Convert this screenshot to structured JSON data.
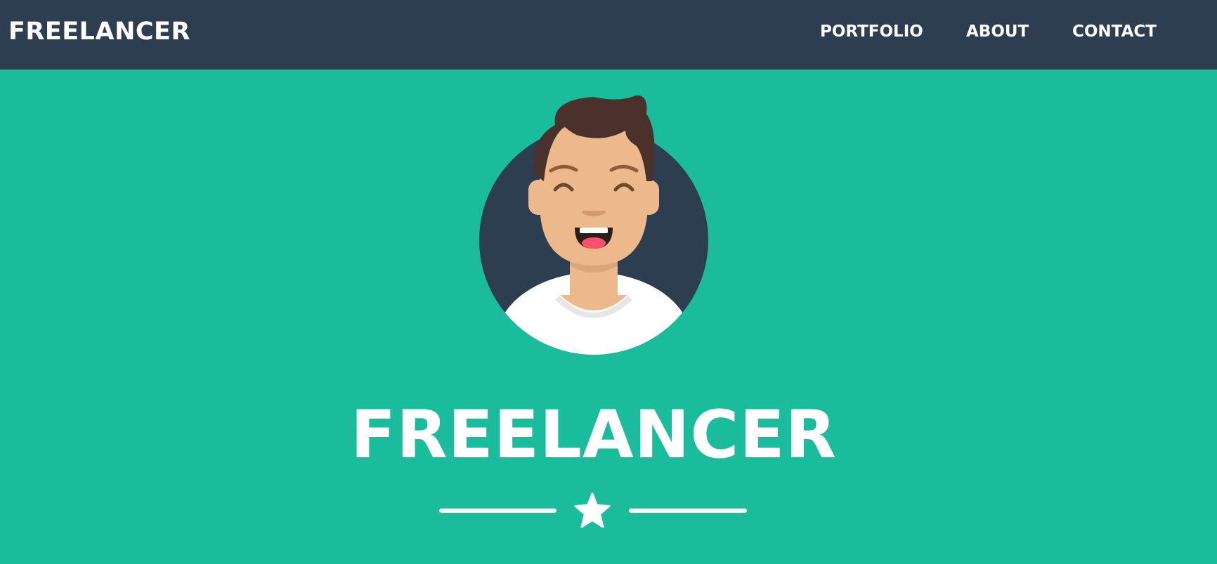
{
  "navbar": {
    "brand": "FREELANCER",
    "links": [
      "PORTFOLIO",
      "ABOUT",
      "CONTACT"
    ]
  },
  "masthead": {
    "title": "FREELANCER",
    "avatar_icon": "avatar-illustration",
    "divider_icon": "star-icon"
  },
  "colors": {
    "primary": "#1abc9c",
    "secondary": "#2c3e50",
    "text": "#ffffff"
  }
}
